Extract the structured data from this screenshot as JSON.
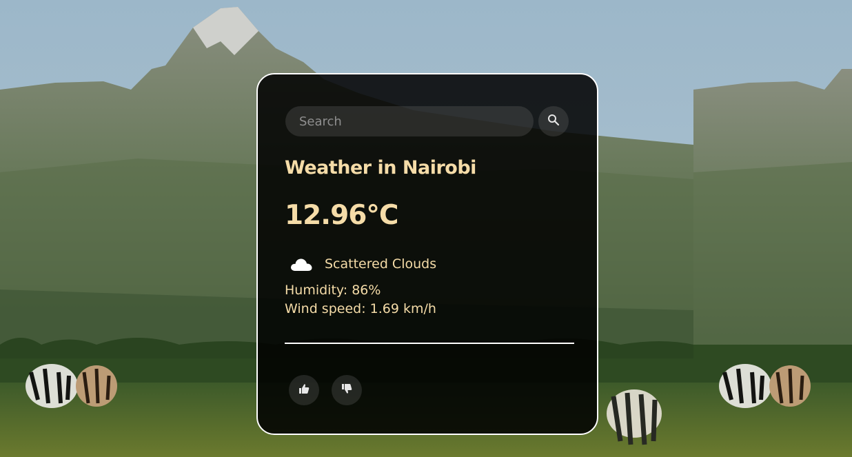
{
  "search": {
    "placeholder": "Search",
    "button_icon": "search-icon"
  },
  "weather": {
    "title": "Weather in Nairobi",
    "temperature": "12.96°C",
    "condition": "Scattered Clouds",
    "condition_icon": "cloud-icon",
    "humidity": "Humidity: 86%",
    "wind": "Wind speed: 1.69 km/h"
  },
  "feedback": {
    "like_icon": "thumbs-up-icon",
    "dislike_icon": "thumbs-down-icon"
  },
  "colors": {
    "text_accent": "#f5dca8",
    "card_background": "rgba(0,0,0,0.86)",
    "card_border": "#ffffff"
  }
}
